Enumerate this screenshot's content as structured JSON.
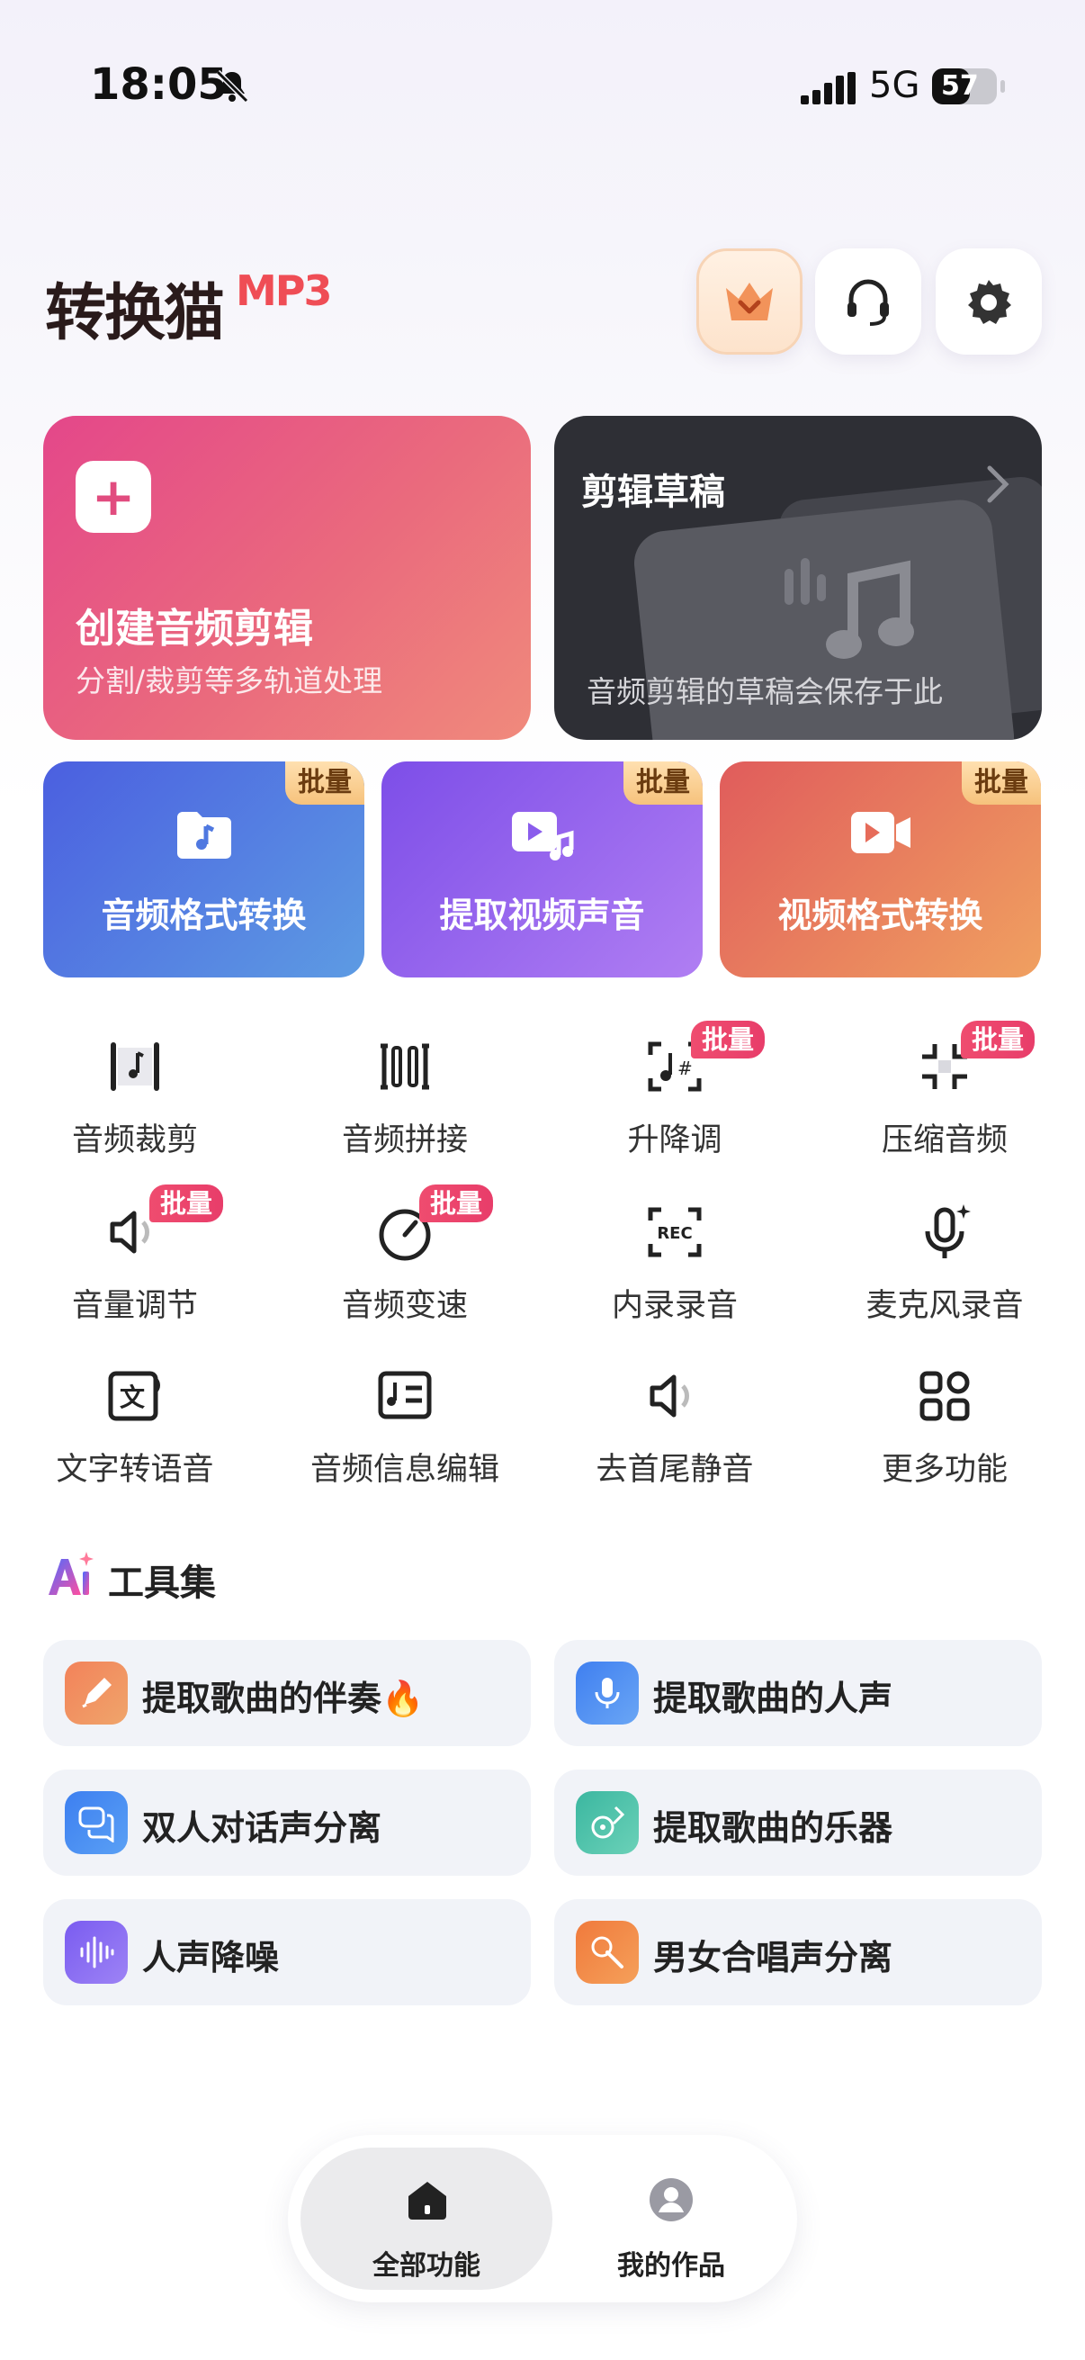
{
  "status_bar": {
    "time": "18:05",
    "network": "5G",
    "battery": "57"
  },
  "header": {
    "logo_text": "转换猫",
    "logo_suffix": "MP3",
    "icons": [
      "vip-crown-icon",
      "headset-icon",
      "gear-icon"
    ]
  },
  "create_card": {
    "title": "创建音频剪辑",
    "subtitle": "分割/裁剪等多轨道处理"
  },
  "draft_card": {
    "title": "剪辑草稿",
    "subtitle": "音频剪辑的草稿会保存于此"
  },
  "batch_cards": [
    {
      "label": "音频格式转换",
      "tag": "批量",
      "color": "#4a6ee0"
    },
    {
      "label": "提取视频声音",
      "tag": "批量",
      "color": "#8c5ef0"
    },
    {
      "label": "视频格式转换",
      "tag": "批量",
      "color": "#e86a5a"
    }
  ],
  "grid": [
    {
      "label": "音频裁剪",
      "tag": ""
    },
    {
      "label": "音频拼接",
      "tag": ""
    },
    {
      "label": "升降调",
      "tag": "批量"
    },
    {
      "label": "压缩音频",
      "tag": "批量"
    },
    {
      "label": "音量调节",
      "tag": "批量"
    },
    {
      "label": "音频变速",
      "tag": "批量"
    },
    {
      "label": "内录录音",
      "tag": ""
    },
    {
      "label": "麦克风录音",
      "tag": ""
    },
    {
      "label": "文字转语音",
      "tag": ""
    },
    {
      "label": "音频信息编辑",
      "tag": ""
    },
    {
      "label": "去首尾静音",
      "tag": ""
    },
    {
      "label": "更多功能",
      "tag": ""
    }
  ],
  "rec_label": "REC",
  "tools": {
    "title": "工具集",
    "items": [
      {
        "label": "提取歌曲的伴奏",
        "emoji": "🔥"
      },
      {
        "label": "提取歌曲的人声"
      },
      {
        "label": "双人对话声分离"
      },
      {
        "label": "提取歌曲的乐器"
      },
      {
        "label": "人声降噪"
      },
      {
        "label": "男女合唱声分离"
      }
    ]
  },
  "nav": {
    "all_features": "全部功能",
    "my_works": "我的作品"
  }
}
